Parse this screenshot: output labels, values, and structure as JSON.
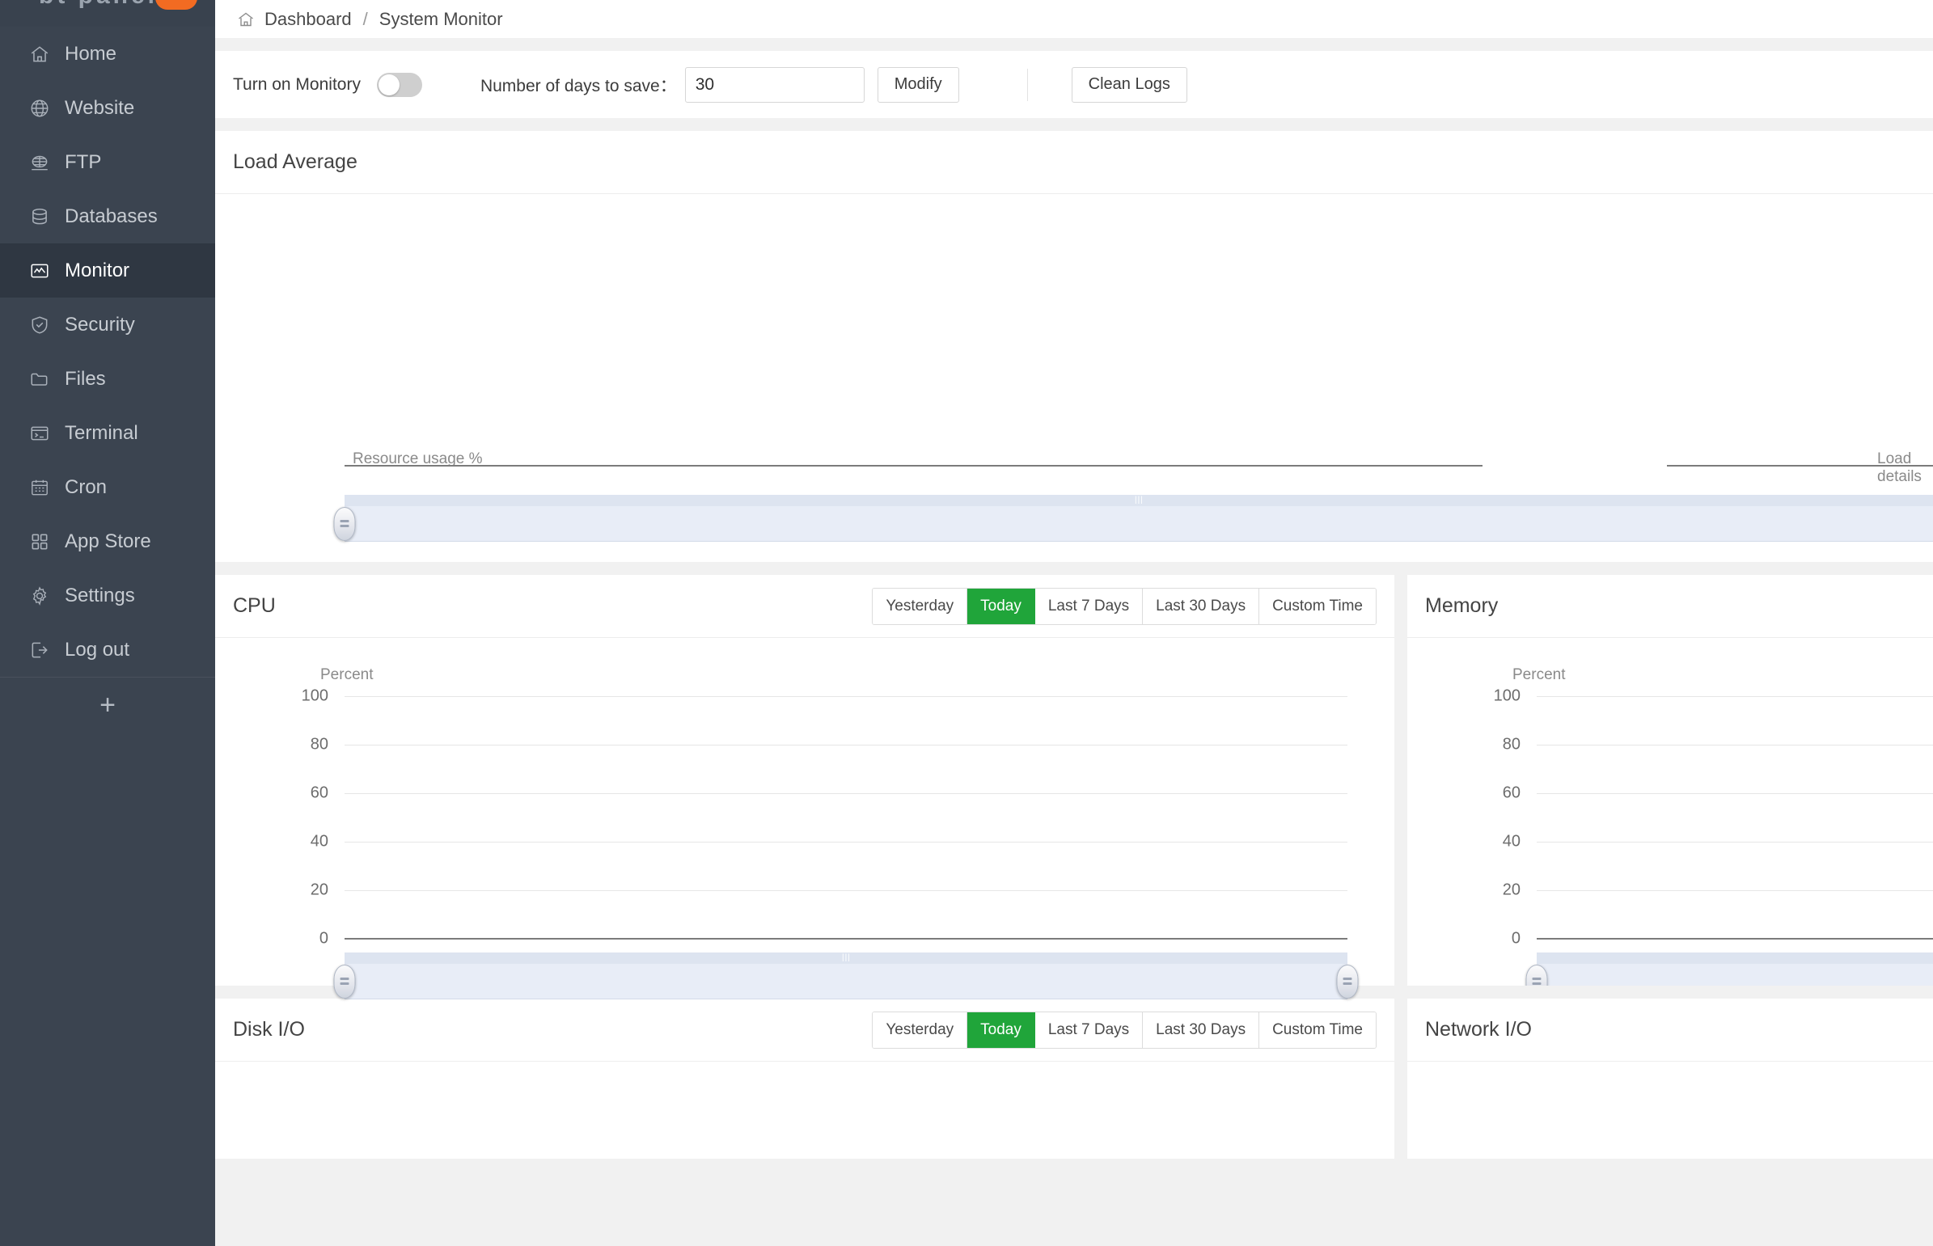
{
  "sidebar": {
    "logo_fragment": "bt  panel",
    "items": [
      {
        "label": "Home",
        "icon": "home-icon",
        "active": false
      },
      {
        "label": "Website",
        "icon": "globe-icon",
        "active": false
      },
      {
        "label": "FTP",
        "icon": "ftp-icon",
        "active": false
      },
      {
        "label": "Databases",
        "icon": "database-icon",
        "active": false
      },
      {
        "label": "Monitor",
        "icon": "monitor-icon",
        "active": true
      },
      {
        "label": "Security",
        "icon": "shield-icon",
        "active": false
      },
      {
        "label": "Files",
        "icon": "folder-icon",
        "active": false
      },
      {
        "label": "Terminal",
        "icon": "terminal-icon",
        "active": false
      },
      {
        "label": "Cron",
        "icon": "calendar-icon",
        "active": false
      },
      {
        "label": "App Store",
        "icon": "grid-icon",
        "active": false
      },
      {
        "label": "Settings",
        "icon": "gear-icon",
        "active": false
      },
      {
        "label": "Log out",
        "icon": "logout-icon",
        "active": false
      }
    ],
    "add_label": "+"
  },
  "breadcrumb": {
    "home_icon": "home-icon",
    "root": "Dashboard",
    "separator": "/",
    "current": "System Monitor"
  },
  "toolbar": {
    "monitor_toggle_label": "Turn on Monitory",
    "monitor_toggle_on": false,
    "days_label": "Number of days to save：",
    "days_value": "30",
    "days_placeholder": "30",
    "modify_label": "Modify",
    "clean_logs_label": "Clean Logs"
  },
  "load_average": {
    "title": "Load Average",
    "resource_label": "Resource usage %",
    "details_label": "Load details"
  },
  "time_ranges": {
    "options": [
      "Yesterday",
      "Today",
      "Last 7 Days",
      "Last 30 Days",
      "Custom Time"
    ],
    "selected": "Today"
  },
  "panels": {
    "cpu": {
      "title": "CPU"
    },
    "memory": {
      "title": "Memory"
    },
    "disk_io": {
      "title": "Disk I/O"
    },
    "network_io": {
      "title": "Network I/O"
    }
  },
  "colors": {
    "accent_green": "#20a53a",
    "sidebar_bg": "#3b4450",
    "sidebar_active": "#2f3742",
    "badge_orange": "#f26b22",
    "datazoom_fill": "#e8edf7"
  },
  "chart_data": [
    {
      "type": "line",
      "title": "Load Average",
      "ylabel": "Resource usage %",
      "annotations": [
        "Resource usage %",
        "Load details"
      ],
      "series": [],
      "x": [],
      "grid": false,
      "legend": "none",
      "note": "empty chart - no data plotted"
    },
    {
      "type": "line",
      "title": "CPU",
      "ylabel": "Percent",
      "yticks": [
        0,
        20,
        40,
        60,
        80,
        100
      ],
      "ylim": [
        0,
        100
      ],
      "series": [],
      "x": [],
      "grid": true,
      "legend": "none",
      "note": "empty chart - no data plotted"
    },
    {
      "type": "line",
      "title": "Memory",
      "ylabel": "Percent",
      "yticks": [
        0,
        20,
        40,
        60,
        80,
        100
      ],
      "ylim": [
        0,
        100
      ],
      "series": [],
      "x": [],
      "grid": true,
      "legend": "none",
      "note": "empty chart - no data plotted"
    },
    {
      "type": "line",
      "title": "Disk I/O",
      "series": [],
      "x": [],
      "grid": true,
      "legend": "none",
      "note": "empty chart - no data plotted"
    },
    {
      "type": "line",
      "title": "Network I/O",
      "series": [],
      "x": [],
      "grid": true,
      "legend": "none",
      "note": "empty chart - no data plotted"
    }
  ],
  "yticks": {
    "t100": "100",
    "t80": "80",
    "t60": "60",
    "t40": "40",
    "t20": "20",
    "t0": "0"
  },
  "percent_label": "Percent"
}
